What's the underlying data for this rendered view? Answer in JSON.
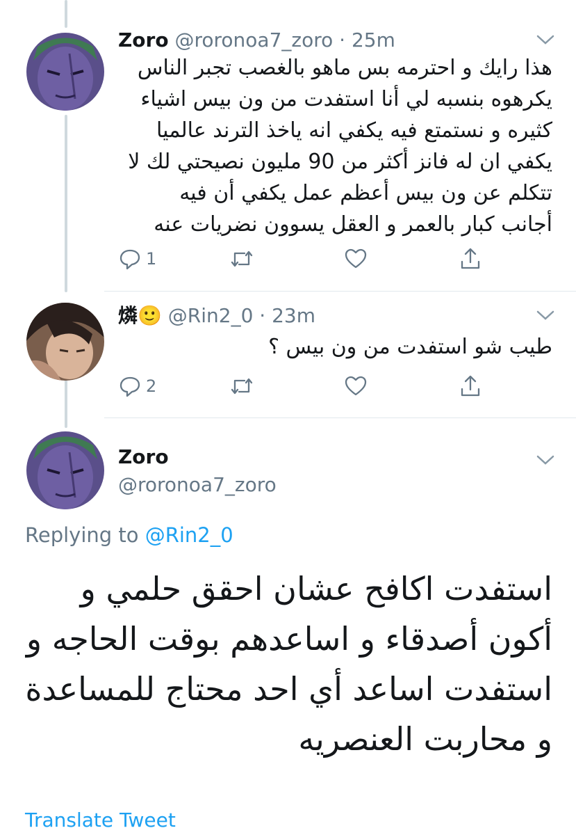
{
  "colors": {
    "accent": "#1da1f2",
    "muted": "#657786",
    "text": "#14171a",
    "border": "#e1e8ed"
  },
  "tweets": [
    {
      "name": "Zoro",
      "handle": "@roronoa7_zoro",
      "sep": "·",
      "time": "25m",
      "text": "هذا رايك و احترمه بس ماهو بالغصب تجبر الناس\nيكرهوه بنسبه لي أنا استفدت من ون بيس اشياء\nكثيره و نستمتع فيه يكفي انه ياخذ الترند عالميا\nيكفي ان له فانز أكثر من 90 مليون نصيحتي لك لا\nتتكلم عن ون بيس أعظم عمل يكفي أن فيه\nأجانب كبار بالعمر و العقل يسوون نضريات عنه",
      "reply_count": "1"
    },
    {
      "name": "燐🙂",
      "handle": "@Rin2_0",
      "sep": "·",
      "time": "23m",
      "text": "طيب شو استفدت من ون بيس ؟",
      "reply_count": "2"
    }
  ],
  "main_tweet": {
    "name": "Zoro",
    "handle": "@roronoa7_zoro",
    "replying_label": "Replying to",
    "replying_handle": "@Rin2_0",
    "text": "استفدت اكافح عشان احقق حلمي و أكون أصدقاء و اساعدهم بوقت الحاجه و استفدت اساعد أي احد محتاج للمساعدة و محاربت العنصريه",
    "translate_label": "Translate Tweet"
  },
  "icons": [
    "reply-icon",
    "retweet-icon",
    "like-icon",
    "share-icon",
    "chevron-down-icon"
  ]
}
